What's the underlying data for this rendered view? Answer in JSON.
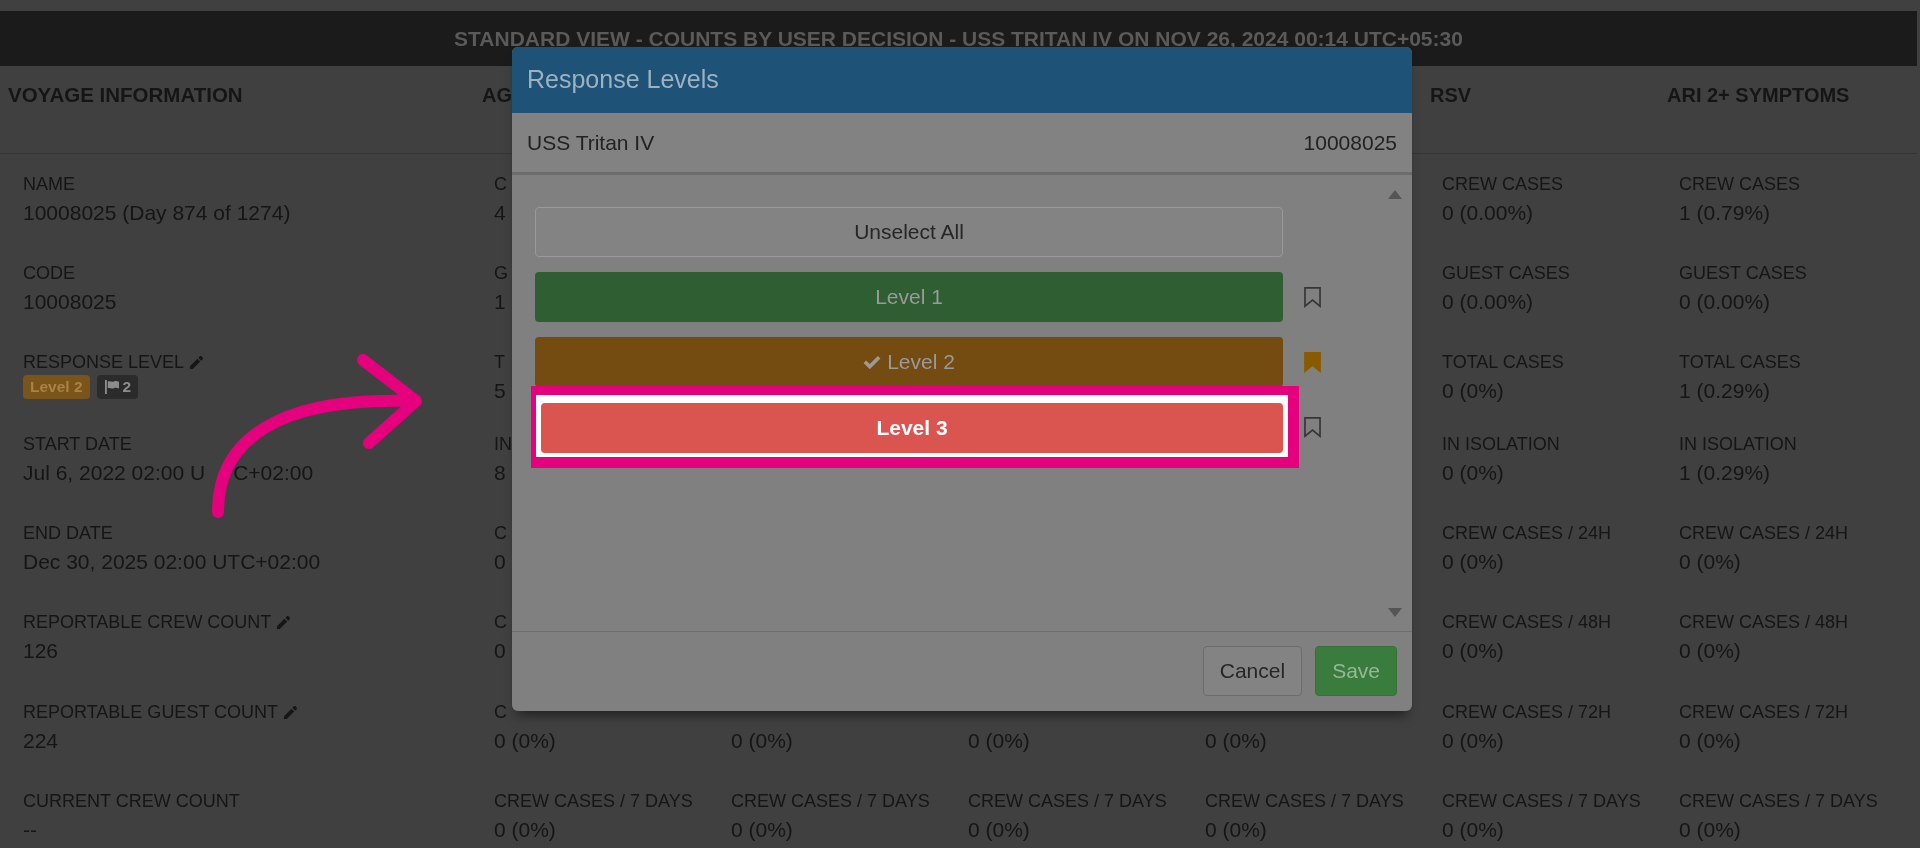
{
  "banner": {
    "title": "STANDARD VIEW - COUNTS BY USER DECISION - USS TRITAN IV ON NOV 26, 2024 00:14 UTC+05:30"
  },
  "voyage": {
    "heading": "VOYAGE INFORMATION",
    "fields": [
      {
        "kind": "text",
        "label": "NAME",
        "value": "10008025 (Day 874 of 1274)",
        "editable": false
      },
      {
        "kind": "text",
        "label": "CODE",
        "value": "10008025",
        "editable": false
      },
      {
        "kind": "badges",
        "label": "RESPONSE LEVEL",
        "editable": true,
        "badges": [
          {
            "kind": "level",
            "text": "Level 2",
            "color": "#7a5419"
          },
          {
            "kind": "flag",
            "text": "2",
            "color": "#2b2b2b"
          }
        ]
      },
      {
        "kind": "covered_text",
        "label": "START DATE",
        "value_parts": [
          "Jul 6, 2022 02:00 U",
          "C+02:00"
        ],
        "editable": false
      },
      {
        "kind": "text",
        "label": "END DATE",
        "value": "Dec 30, 2025 02:00 UTC+02:00",
        "editable": false
      },
      {
        "kind": "text",
        "label": "REPORTABLE CREW COUNT",
        "value": "126",
        "editable": true
      },
      {
        "kind": "text",
        "label": "REPORTABLE GUEST COUNT",
        "value": "224",
        "editable": true
      },
      {
        "kind": "text",
        "label": "CURRENT CREW COUNT",
        "value": "--",
        "editable": false
      }
    ]
  },
  "stat_columns": [
    {
      "heading": "AG",
      "cells": [
        {
          "label": "C",
          "value": "4"
        },
        {
          "label": "G",
          "value": "1"
        },
        {
          "label": "T",
          "value": "5"
        },
        {
          "label": "IN",
          "value": "8"
        },
        {
          "label": "C",
          "value": "0"
        },
        {
          "label": "C",
          "value": "0"
        },
        {
          "label": "C",
          "value": "0 (0%)"
        },
        {
          "label": "CREW CASES / 7 DAYS",
          "value": "0 (0%)"
        }
      ]
    },
    {
      "cells": [
        {
          "value": "0 (0%)"
        },
        {
          "label": "CREW CASES / 7 DAYS",
          "value": "0 (0%)"
        }
      ]
    },
    {
      "cells": [
        {
          "value": "0 (0%)"
        },
        {
          "label": "CREW CASES / 7 DAYS",
          "value": "0 (0%)"
        }
      ]
    },
    {
      "cells": [
        {
          "value": "0 (0%)"
        },
        {
          "label": "CREW CASES / 7 DAYS",
          "value": "0 (0%)"
        }
      ]
    },
    {
      "heading": "RSV",
      "cells": [
        {
          "label": "CREW CASES",
          "value": "0 (0.00%)"
        },
        {
          "label": "GUEST CASES",
          "value": "0 (0.00%)"
        },
        {
          "label": "TOTAL CASES",
          "value": "0 (0%)"
        },
        {
          "label": "IN ISOLATION",
          "value": "0 (0%)"
        },
        {
          "label": "CREW CASES / 24H",
          "value": "0 (0%)"
        },
        {
          "label": "CREW CASES / 48H",
          "value": "0 (0%)"
        },
        {
          "label": "CREW CASES / 72H",
          "value": "0 (0%)"
        },
        {
          "label": "CREW CASES / 7 DAYS",
          "value": "0 (0%)"
        }
      ]
    },
    {
      "heading": "ARI 2+ SYMPTOMS",
      "cells": [
        {
          "label": "CREW CASES",
          "value": "1 (0.79%)"
        },
        {
          "label": "GUEST CASES",
          "value": "0 (0.00%)"
        },
        {
          "label": "TOTAL CASES",
          "value": "1 (0.29%)"
        },
        {
          "label": "IN ISOLATION",
          "value": "1 (0.29%)"
        },
        {
          "label": "CREW CASES / 24H",
          "value": "0 (0%)"
        },
        {
          "label": "CREW CASES / 48H",
          "value": "0 (0%)"
        },
        {
          "label": "CREW CASES / 72H",
          "value": "0 (0%)"
        },
        {
          "label": "CREW CASES / 7 DAYS",
          "value": "0 (0%)"
        }
      ]
    }
  ],
  "modal": {
    "title": "Response Levels",
    "voyage_name": "USS Tritan IV",
    "voyage_code": "10008025",
    "unselect_label": "Unselect All",
    "levels": [
      {
        "label": "Level 1",
        "color": "#2e5e31",
        "selected": false,
        "bookmarked": false,
        "highlighted": false
      },
      {
        "label": "Level 2",
        "color": "#744b11",
        "selected": true,
        "bookmarked": true,
        "highlighted": false
      },
      {
        "label": "Level 3",
        "color": "#db5550",
        "selected": false,
        "bookmarked": false,
        "highlighted": true
      }
    ],
    "buttons": [
      {
        "kind": "cancel",
        "label": "Cancel"
      },
      {
        "kind": "save",
        "label": "Save"
      }
    ]
  }
}
